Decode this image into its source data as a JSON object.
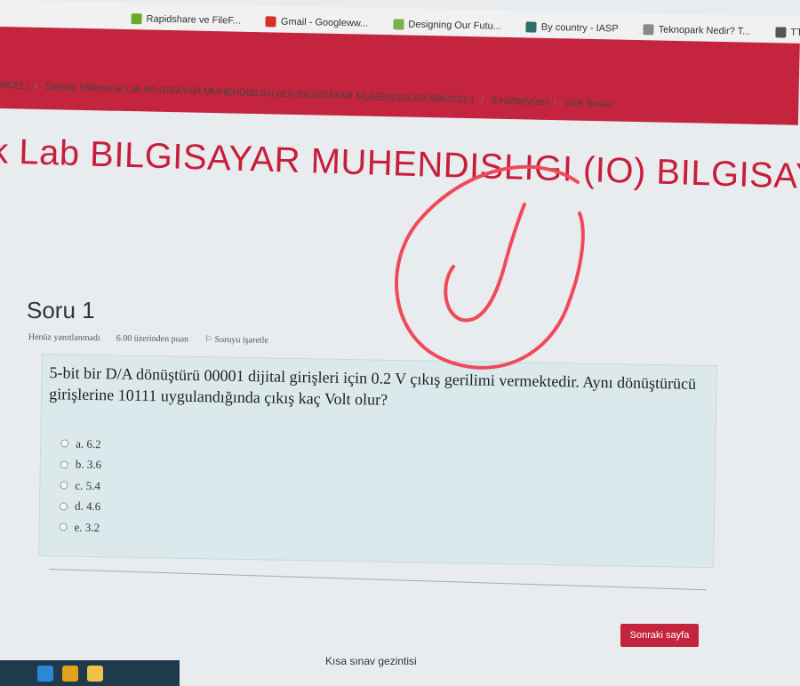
{
  "bookmarks": [
    {
      "label": "Rapidshare ve FileF...",
      "icon": "star-icon",
      "color": "#6aaa2a"
    },
    {
      "label": "Gmail - Googleww...",
      "icon": "gmail-icon",
      "color": "#d93025"
    },
    {
      "label": "Designing Our Futu...",
      "icon": "page-icon",
      "color": "#78b24a"
    },
    {
      "label": "By country - IASP",
      "icon": "globe-icon",
      "color": "#2c6e6a"
    },
    {
      "label": "Teknopark Nedir? T...",
      "icon": "link-icon",
      "color": "#888888"
    },
    {
      "label": "TTGB_STRATEJIK_",
      "icon": "site-icon",
      "color": "#555555"
    }
  ],
  "breadcrumb": [
    "NCEL)",
    "Sayisal Elektronik Lab BILGISAYAR MUHENDISLIGI (IO) BILGISAYAR MUHENDISLIGI BMU232 1",
    "9.Hafta(Vize)",
    "Vize Sınavı"
  ],
  "course_title": "k Lab BILGISAYAR MUHENDISLIGI (IO) BILGISAYAR MU",
  "question": {
    "heading": "Soru 1",
    "status": "Henüz yanıtlanmadı",
    "points": "6.00 üzerinden puan",
    "flag": "Soruyu işaretle",
    "text": "5-bit bir D/A dönüştürü 00001 dijital girişleri için 0.2 V çıkış gerilimi vermektedir. Aynı dönüştürücü girişlerine 10111 uygulandığında çıkış kaç Volt olur?",
    "options": [
      "a. 6.2",
      "b. 3.6",
      "c. 5.4",
      "d. 4.6",
      "e. 3.2"
    ]
  },
  "next_button": "Sonraki sayfa",
  "quiz_nav": "Kısa sınav gezintisi",
  "colors": {
    "accent": "#c4243e",
    "annotation": "#f04a5a"
  },
  "annotation": "hand-drawn-check-circle"
}
